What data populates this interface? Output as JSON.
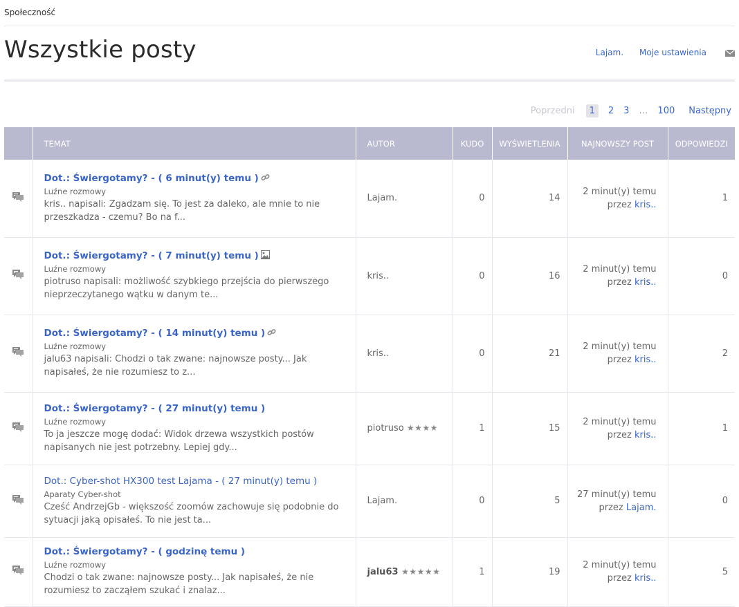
{
  "breadcrumb": "Społeczność",
  "page_title": "Wszystkie posty",
  "header_links": {
    "user": "Lajam.",
    "settings": "Moje ustawienia",
    "mail_icon": "envelope-icon"
  },
  "pagination": {
    "prev": "Poprzedni",
    "current": "1",
    "pages": [
      "2",
      "3"
    ],
    "ellipsis": "…",
    "last": "100",
    "next": "Następny"
  },
  "columns": {
    "topic": "TEMAT",
    "author": "AUTOR",
    "kudo": "KUDO",
    "views": "WYŚWIETLENIA",
    "latest": "NAJNOWSZY POST",
    "replies": "ODPOWIEDZI"
  },
  "posts": [
    {
      "title": "Dot.: Świergotamy? - ( 6 minut(y) temu )",
      "badge": "link-icon",
      "board": "Luźne rozmowy",
      "snippet": "kris.. napisali: Zgadzam się. To jest za daleko, ale mnie to nie przeszkadza - czemu? Bo na f...",
      "author": "Lajam.",
      "author_stars": "",
      "kudo": "0",
      "views": "14",
      "latest_time": "2 minut(y) temu",
      "latest_by": "przez",
      "latest_user": "kris..",
      "replies": "1"
    },
    {
      "title": "Dot.: Świergotamy? - ( 7 minut(y) temu )",
      "badge": "image-icon",
      "board": "Luźne rozmowy",
      "snippet": "piotruso napisali: możliwość szybkiego przejścia do pierwszego nieprzeczytanego wątku w danym te...",
      "author": "kris..",
      "author_stars": "",
      "kudo": "0",
      "views": "16",
      "latest_time": "2 minut(y) temu",
      "latest_by": "przez",
      "latest_user": "kris..",
      "replies": "0"
    },
    {
      "title": "Dot.: Świergotamy? - ( 14 minut(y) temu )",
      "badge": "link-icon",
      "board": "Luźne rozmowy",
      "snippet": "jalu63 napisali: Chodzi o tak zwane: najnowsze posty... Jak napisałeś, że nie rozumiesz to z...",
      "author": "kris..",
      "author_stars": "",
      "kudo": "0",
      "views": "21",
      "latest_time": "2 minut(y) temu",
      "latest_by": "przez",
      "latest_user": "kris..",
      "replies": "2"
    },
    {
      "title": "Dot.: Świergotamy? - ( 27 minut(y) temu )",
      "badge": "",
      "board": "Luźne rozmowy",
      "snippet": "To ja jeszcze mogę dodać: Widok drzewa wszystkich postów napisanych nie jest potrzebny. Lepiej gdy...",
      "author": "piotruso",
      "author_stars": "★★★★",
      "kudo": "1",
      "views": "15",
      "latest_time": "2 minut(y) temu",
      "latest_by": "przez",
      "latest_user": "kris..",
      "replies": "1"
    },
    {
      "title": "Dot.: Cyber-shot HX300 test Lajama - ( 27 minut(y) temu )",
      "badge": "",
      "title_weight": "normal",
      "board": "Aparaty Cyber-shot",
      "snippet": "Cześć AndrzejGb - większość zoomów zachowuje się podobnie do sytuacji jaką opisałeś. To nie jest ta...",
      "author": "Lajam.",
      "author_stars": "",
      "kudo": "0",
      "views": "5",
      "latest_time": "27 minut(y) temu",
      "latest_by": "przez",
      "latest_user": "Lajam.",
      "replies": "0"
    },
    {
      "title": "Dot.: Świergotamy? - ( godzinę temu )",
      "badge": "",
      "board": "Luźne rozmowy",
      "snippet": "Chodzi o tak zwane: najnowsze posty... Jak napisałeś, że nie rozumiesz to zacząłem szukać i znalaz...",
      "author": "jalu63",
      "author_bold": true,
      "author_stars": "★★★★★",
      "kudo": "1",
      "views": "19",
      "latest_time": "2 minut(y) temu",
      "latest_by": "przez",
      "latest_user": "kris..",
      "replies": "5"
    }
  ],
  "row_icon": "discussion-icon",
  "colors": {
    "accent": "#3a65c7",
    "header_bg": "#b9b9cf",
    "row_border": "#e6e6ec"
  }
}
